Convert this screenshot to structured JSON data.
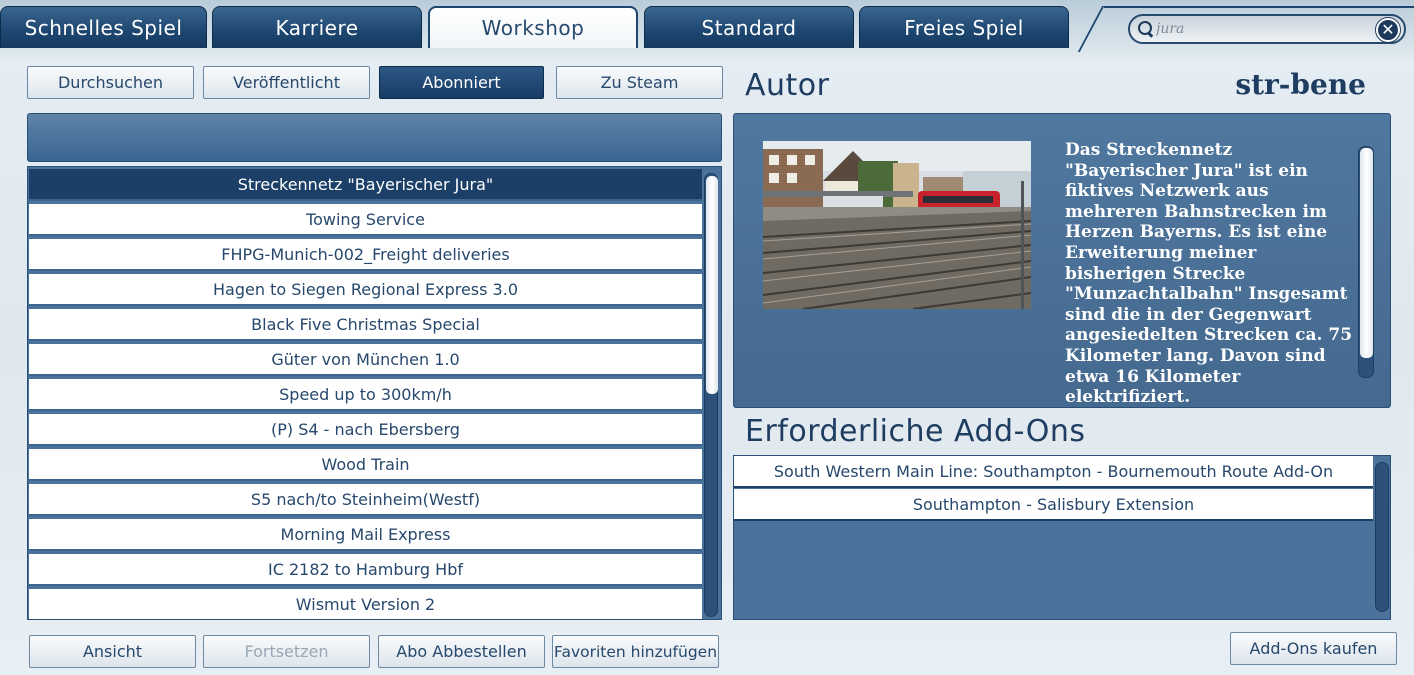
{
  "tabs": [
    {
      "label": "Schnelles Spiel"
    },
    {
      "label": "Karriere"
    },
    {
      "label": "Workshop"
    },
    {
      "label": "Standard"
    },
    {
      "label": "Freies Spiel"
    }
  ],
  "active_tab": "Workshop",
  "search": {
    "value": "jura"
  },
  "filter_buttons": [
    {
      "label": "Durchsuchen"
    },
    {
      "label": "Veröffentlicht"
    },
    {
      "label": "Abonniert",
      "selected": true
    },
    {
      "label": "Zu Steam"
    }
  ],
  "list": {
    "items": [
      "Streckennetz \"Bayerischer Jura\"",
      "Towing Service",
      "FHPG-Munich-002_Freight deliveries",
      "Hagen to Siegen Regional Express 3.0",
      "Black Five Christmas Special",
      "Güter von München 1.0",
      "Speed up to 300km/h",
      "(P) S4 - nach Ebersberg",
      "Wood Train",
      "S5 nach/to Steinheim(Westf)",
      "Morning Mail Express",
      "IC 2182 to Hamburg Hbf",
      "Wismut Version 2"
    ],
    "selected_index": 0
  },
  "bottom_buttons": {
    "view": "Ansicht",
    "continue": "Fortsetzen",
    "unsubscribe": "Abo Abbestellen",
    "favorite": "Favoriten hinzufügen"
  },
  "author": {
    "heading": "Autor",
    "name": "str-bene"
  },
  "description": "Das Streckennetz \"Bayerischer Jura\" ist ein fiktives Netzwerk aus mehreren Bahnstrecken im Herzen Bayerns. Es ist eine Erweiterung meiner bisherigen Strecke \"Munzachtalbahn\" Insgesamt sind die in der Gegenwart angesiedelten Strecken ca. 75 Kilometer lang. Davon sind etwa 16 Kilometer elektrifiziert.",
  "addons": {
    "heading": "Erforderliche Add-Ons",
    "items": [
      "South Western Main Line: Southampton - Bournemouth Route Add-On",
      "Southampton - Salisbury Extension"
    ],
    "buy_button": "Add-Ons kaufen"
  },
  "colors": {
    "navy": "#1b3f67",
    "panel_blue": "#4b729a",
    "text_blue": "#27486c"
  }
}
